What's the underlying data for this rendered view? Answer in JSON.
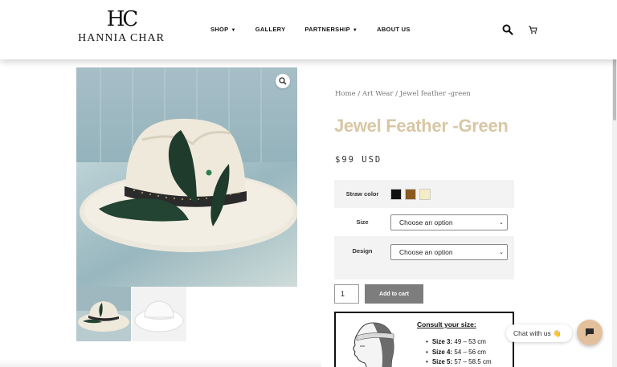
{
  "header": {
    "logo_mark": "HC",
    "logo_text": "HANNIA CHAR",
    "nav": [
      {
        "label": "SHOP",
        "dropdown": true
      },
      {
        "label": "GALLERY",
        "dropdown": false
      },
      {
        "label": "PARTNERSHIP",
        "dropdown": true
      },
      {
        "label": "ABOUT US",
        "dropdown": false
      }
    ],
    "icons": [
      "search-icon",
      "cart-icon"
    ]
  },
  "breadcrumb": {
    "home": "Home",
    "sep1": " / ",
    "category": "Art Wear",
    "sep2": " / ",
    "current": "Jewel feather -green"
  },
  "product": {
    "title": "Jewel Feather -Green",
    "price": "$99 USD",
    "title_color": "#d8c7a5"
  },
  "variations": {
    "straw_label": "Straw color",
    "swatches": [
      {
        "name": "black",
        "color": "#111111"
      },
      {
        "name": "brown",
        "color": "#8a5a22"
      },
      {
        "name": "cream",
        "color": "#f3ecc5"
      }
    ],
    "size_label": "Size",
    "size_value": "Choose an option",
    "design_label": "Design",
    "design_value": "Choose an option"
  },
  "cart": {
    "quantity": "1",
    "add_label": "Add to cart"
  },
  "size_guide": {
    "title": "Consult your size:",
    "sizes": [
      {
        "label": "Size 3:",
        "range": "49 – 53 cm"
      },
      {
        "label": "Size 4:",
        "range": "54 – 56 cm"
      },
      {
        "label": "Size 5:",
        "range": "57 – 58.5 cm"
      }
    ]
  },
  "chat": {
    "label": "Chat with us 👋"
  }
}
